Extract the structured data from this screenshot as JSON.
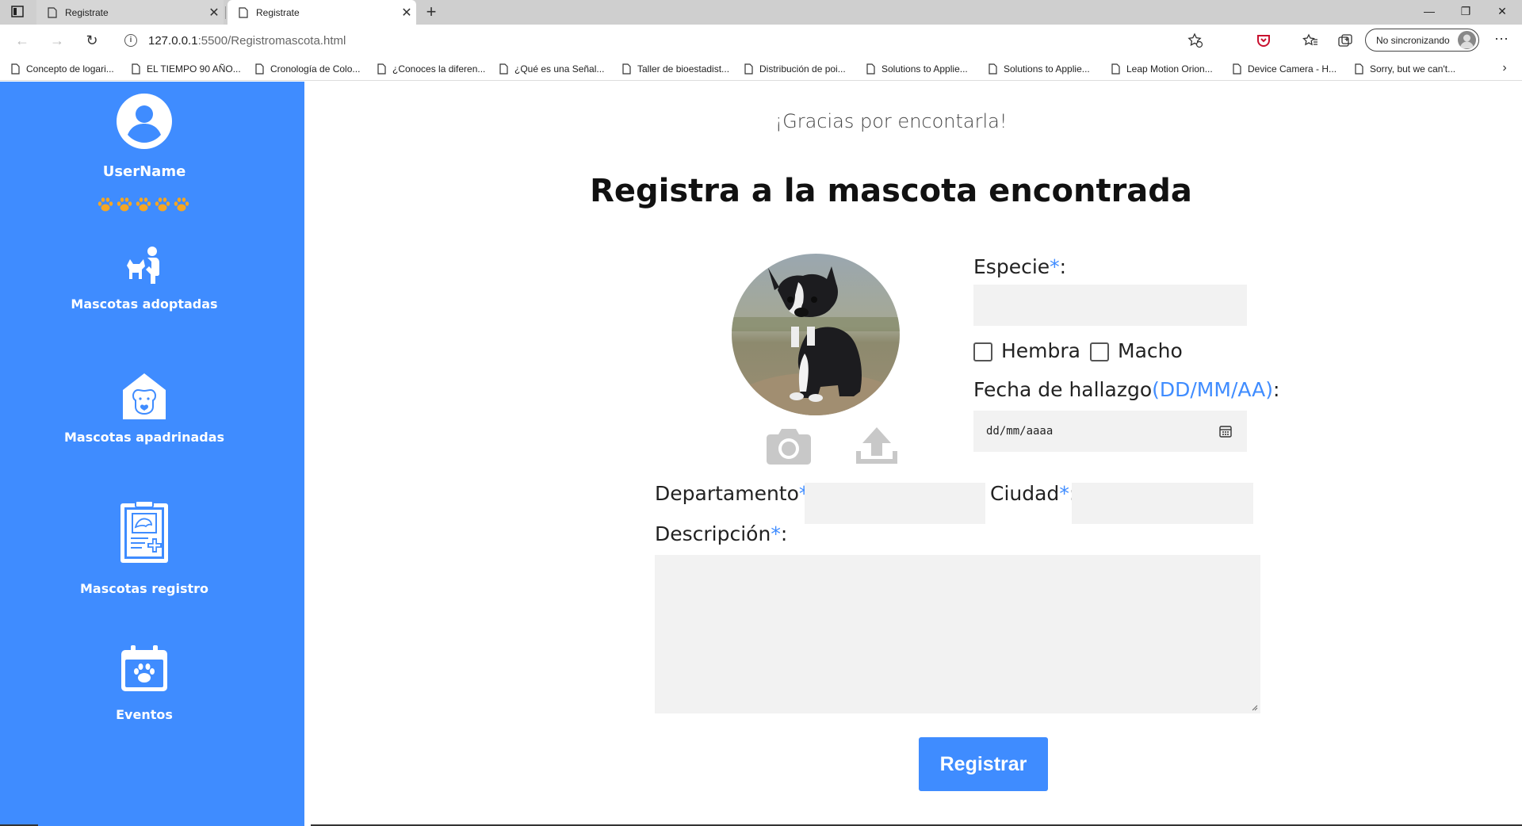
{
  "browser": {
    "tabs": [
      {
        "title": "Registrate",
        "close": "✕"
      },
      {
        "title": "Registrate",
        "close": "✕"
      }
    ],
    "new_tab": "+",
    "window_controls": {
      "minimize": "—",
      "restore": "❐",
      "close": "✕"
    },
    "url_host": "127.0.0.1",
    "url_rest": ":5500/Registromascota.html",
    "profile_label": "No sincronizando",
    "bookmarks": [
      "Concepto de logari...",
      "EL TIEMPO 90 AÑO...",
      "Cronología de Colo...",
      "¿Conoces la diferen...",
      "¿Qué es una Señal...",
      "Taller de bioestadist...",
      "Distribución de poi...",
      "Solutions to Applie...",
      "Solutions to Applie...",
      "Leap Motion Orion...",
      "Device Camera - H...",
      "Sorry, but we can't..."
    ]
  },
  "sidebar": {
    "username": "UserName",
    "rating_stars": 5,
    "items": [
      {
        "label": "Mascotas adoptadas",
        "icon": "adoption-icon"
      },
      {
        "label": "Mascotas apadrinadas",
        "icon": "sponsored-pet-icon"
      },
      {
        "label": "Mascotas registro",
        "icon": "pet-record-icon"
      },
      {
        "label": "Eventos",
        "icon": "events-calendar-icon"
      }
    ]
  },
  "main": {
    "thanks": "¡Gracias por encontarla!",
    "heading": "Registra a la mascota encontrada",
    "form": {
      "especie_label": "Especie",
      "hembra_label": "Hembra",
      "macho_label": "Macho",
      "fecha_label": "Fecha de hallazgo",
      "fecha_hint": "(DD/MM/AA)",
      "fecha_placeholder": "dd/mm/aaaa",
      "departamento_label": "Departamento",
      "ciudad_label": "Ciudad",
      "descripcion_label": "Descripción",
      "required_mark": "*",
      "colon": ":",
      "submit_label": "Registrar"
    }
  },
  "colors": {
    "accent": "#3f8cff",
    "field_bg": "#f2f2f2",
    "paw": "#f5a623"
  }
}
